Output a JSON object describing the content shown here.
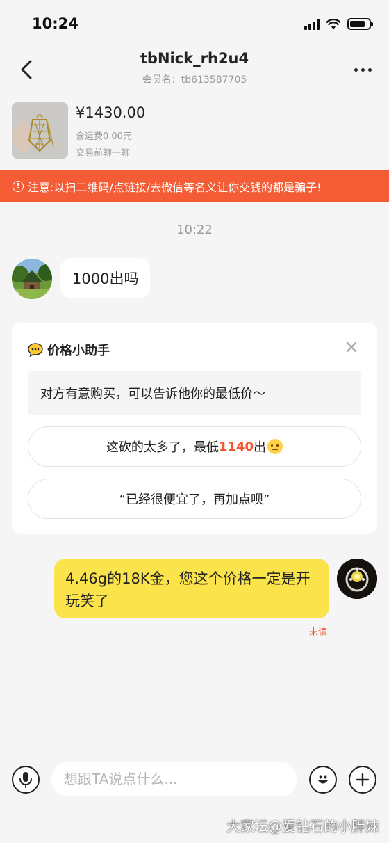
{
  "status_bar": {
    "time": "10:24",
    "battery_level": 0.8
  },
  "nav": {
    "title": "tbNick_rh2u4",
    "subtitle": "会员名：tb613587705",
    "back_icon": "chevron-left-icon",
    "more_icon": "more-dots-icon"
  },
  "product": {
    "price": "¥1430.00",
    "shipping": "含运费0.00元",
    "pre_trade": "交易前聊一聊"
  },
  "warning": {
    "text": "注意:以扫二维码/点链接/去微信等名义让你交钱的都是骗子!",
    "color": "#f45c35"
  },
  "chat": {
    "timestamp": "10:22",
    "incoming_message": "1000出吗",
    "outgoing_message": "4.46g的18K金，您这个价格一定是开玩笑了",
    "outgoing_status": "未读"
  },
  "assistant": {
    "title": "价格小助手",
    "tip": "对方有意购买，可以告诉他你的最低价～",
    "option1_prefix": "这砍的太多了，最低",
    "option1_price": "1140",
    "option1_suffix": "出",
    "option2": "“已经很便宜了，再加点呗”"
  },
  "input": {
    "placeholder": "想跟TA说点什么..."
  },
  "watermark": "大家坛@爱钻石的小胖妹",
  "colors": {
    "accent": "#f45c35",
    "bubble_out": "#fbe34b",
    "background": "#f5f5f5"
  }
}
